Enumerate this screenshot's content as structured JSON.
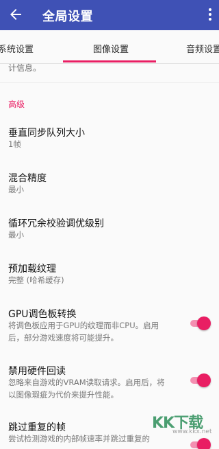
{
  "header": {
    "title": "全局设置",
    "back_icon": "arrow-back-icon",
    "menu_icon": "more-vert-icon"
  },
  "tabs": [
    {
      "label": "系统设置"
    },
    {
      "label": "图像设置",
      "selected": true
    },
    {
      "label": "音频设置"
    }
  ],
  "colors": {
    "appbar": "#3f51b5",
    "accent": "#e91e63"
  },
  "content": {
    "partial_text": "计信息。",
    "section_title": "高级",
    "settings": [
      {
        "title": "垂直同步队列大小",
        "subtitle": "1帧"
      },
      {
        "title": "混合精度",
        "subtitle": "最小"
      },
      {
        "title": "循环冗余校验调优级别",
        "subtitle": "最小"
      },
      {
        "title": "预加载纹理",
        "subtitle": "完整 (哈希缓存)"
      },
      {
        "title": "GPU调色板转换",
        "subtitle": "将调色板应用于GPU的纹理而非CPU。启用后，部分游戏速度将可能提升。",
        "toggle": true
      },
      {
        "title": "禁用硬件回读",
        "subtitle": "忽略来自游戏的VRAM读取请求。启用后，将以图像瑕疵为代价来提升性能。",
        "toggle": true
      },
      {
        "title": "跳过重复的帧",
        "subtitle": "尝试检测游戏的内部帧速率并跳过重复的",
        "toggle": true
      }
    ]
  },
  "watermark": {
    "text": "KK下载",
    "sub": "www.kkx.net"
  }
}
